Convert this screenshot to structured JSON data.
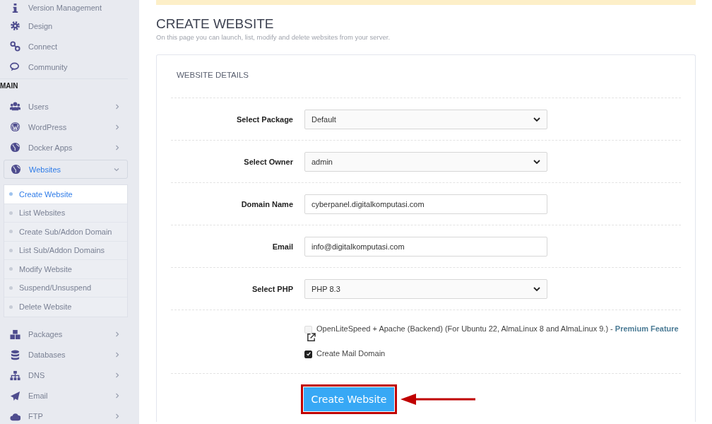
{
  "sidebar": {
    "items": [
      {
        "kind": "link",
        "label": "Version Management",
        "selected": false
      },
      {
        "kind": "link",
        "label": "Design",
        "selected": false
      },
      {
        "kind": "link",
        "label": "Connect",
        "selected": false
      },
      {
        "kind": "link",
        "label": "Community",
        "selected": false
      },
      {
        "kind": "heading",
        "label": "MAIN"
      },
      {
        "kind": "menu",
        "label": "Users",
        "selected": false,
        "expanded": false
      },
      {
        "kind": "menu",
        "label": "WordPress",
        "selected": false,
        "expanded": false
      },
      {
        "kind": "menu",
        "label": "Docker Apps",
        "selected": false,
        "expanded": false
      },
      {
        "kind": "menu",
        "label": "Websites",
        "selected": true,
        "expanded": true,
        "children": [
          {
            "label": "Create Website",
            "selected": true
          },
          {
            "label": "List Websites",
            "selected": false
          },
          {
            "label": "Create Sub/Addon Domain",
            "selected": false
          },
          {
            "label": "List Sub/Addon Domains",
            "selected": false
          },
          {
            "label": "Modify Website",
            "selected": false
          },
          {
            "label": "Suspend/Unsuspend",
            "selected": false
          },
          {
            "label": "Delete Website",
            "selected": false
          }
        ]
      },
      {
        "kind": "menu",
        "label": "Packages",
        "selected": false,
        "expanded": false
      },
      {
        "kind": "menu",
        "label": "Databases",
        "selected": false,
        "expanded": false
      },
      {
        "kind": "menu",
        "label": "DNS",
        "selected": false,
        "expanded": false
      },
      {
        "kind": "menu",
        "label": "Email",
        "selected": false,
        "expanded": false
      },
      {
        "kind": "menu",
        "label": "FTP",
        "selected": false,
        "expanded": false
      }
    ]
  },
  "page": {
    "title": "CREATE WEBSITE",
    "subtitle": "On this page you can launch, list, modify and delete websites from your server."
  },
  "card": {
    "title": "WEBSITE DETAILS",
    "fields": [
      {
        "kind": "select",
        "label": "Select Package",
        "value": "Default"
      },
      {
        "kind": "select",
        "label": "Select Owner",
        "value": "admin"
      },
      {
        "kind": "input",
        "label": "Domain Name",
        "value": "cyberpanel.digitalkomputasi.com"
      },
      {
        "kind": "input",
        "label": "Email",
        "value": "info@digitalkomputasi.com"
      },
      {
        "kind": "select",
        "label": "Select PHP",
        "value": "PHP 8.3"
      }
    ],
    "options": [
      {
        "label": "OpenLiteSpeed + Apache (Backend) (For Ubuntu 22, AlmaLinux 8 and AlmaLinux 9.) - ",
        "link": "Premium Feature",
        "checked": false,
        "disabled": true
      },
      {
        "label": "Create Mail Domain",
        "checked": true,
        "disabled": false
      }
    ],
    "button": "Create Website",
    "highlighted": true
  }
}
